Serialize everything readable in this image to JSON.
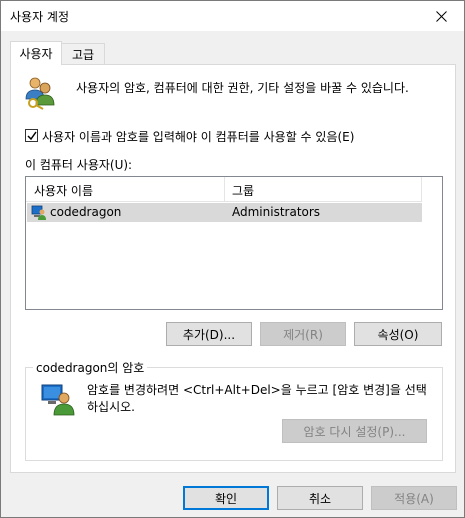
{
  "window": {
    "title": "사용자 계정"
  },
  "tabs": [
    {
      "label": "사용자",
      "active": true
    },
    {
      "label": "고급",
      "active": false
    }
  ],
  "intro": {
    "text": "사용자의 암호, 컴퓨터에 대한 권한, 기타 설정을 바꿀 수 있습니다."
  },
  "require_login": {
    "label": "사용자 이름과 암호를 입력해야 이 컴퓨터를 사용할 수 있음(E)",
    "checked": true
  },
  "users_list": {
    "label": "이 컴퓨터 사용자(U):",
    "columns": [
      "사용자 이름",
      "그룹"
    ],
    "rows": [
      {
        "name": "codedragon",
        "group": "Administrators",
        "selected": true
      }
    ]
  },
  "list_buttons": {
    "add": "추가(D)...",
    "remove": "제거(R)",
    "properties": "속성(O)"
  },
  "password_group": {
    "title": "codedragon의 암호",
    "text": "암호를 변경하려면 <Ctrl+Alt+Del>을 누르고 [암호 변경]을 선택하십시오.",
    "reset_button": "암호 다시 설정(P)..."
  },
  "dialog_buttons": {
    "ok": "확인",
    "cancel": "취소",
    "apply": "적용(A)"
  },
  "colors": {
    "accent": "#0078d7",
    "selection": "#d9d9d9",
    "window_bg": "#f0f0f0"
  }
}
